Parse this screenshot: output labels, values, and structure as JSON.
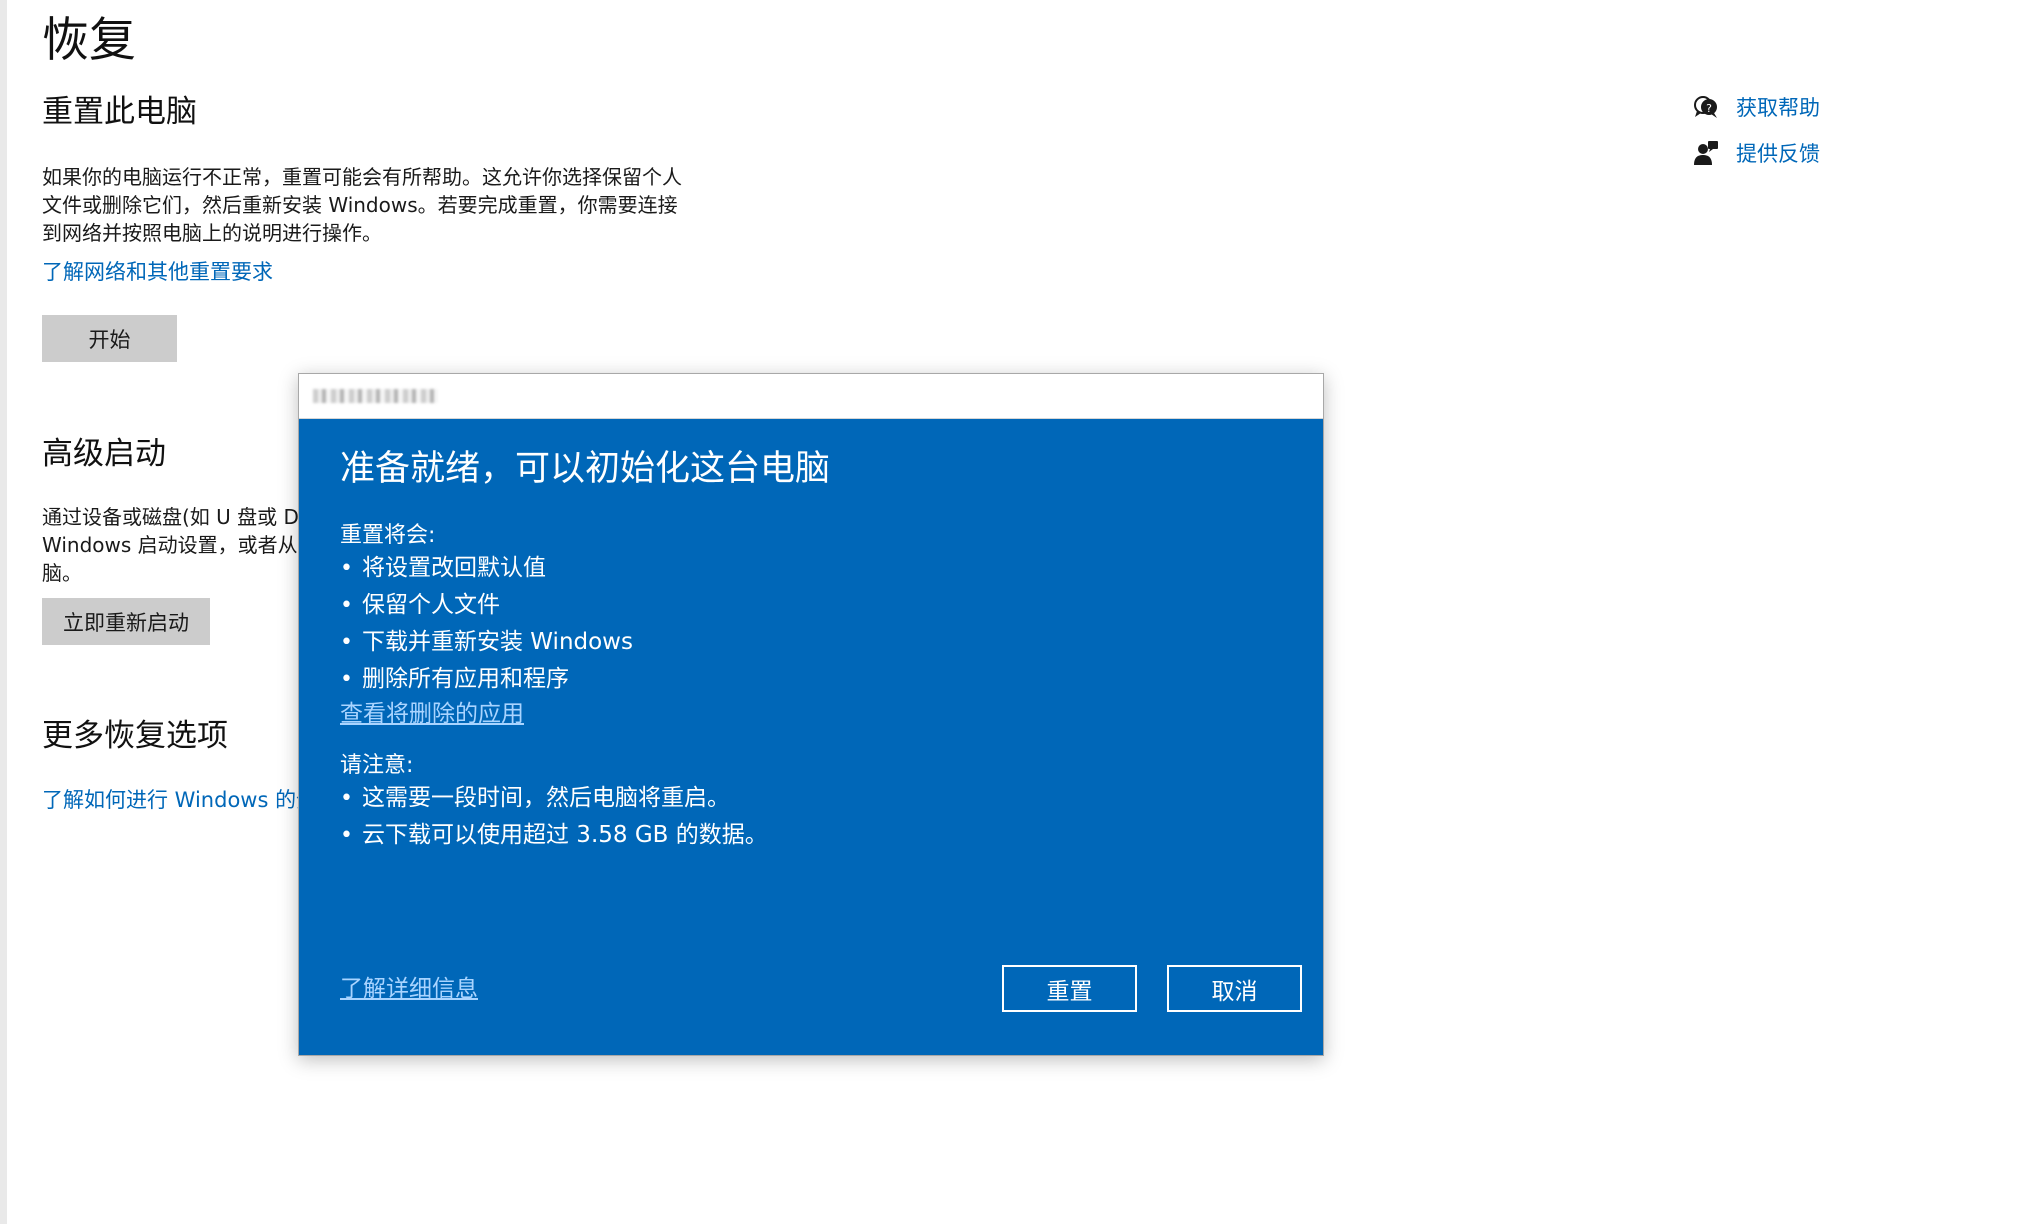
{
  "page": {
    "title": "恢复"
  },
  "reset_section": {
    "title": "重置此电脑",
    "description_lines": [
      "如果你的电脑运行不正常，重置可能会有所帮助。这允许你选择保留个人",
      "文件或删除它们，然后重新安装 Windows。若要完成重置，你需要连接",
      "到网络并按照电脑上的说明进行操作。"
    ],
    "link": "了解网络和其他重置要求",
    "button": "开始"
  },
  "advanced_section": {
    "title": "高级启动",
    "description_lines": [
      "通过设备或磁盘(如 U 盘或 D",
      "Windows 启动设置，或者从",
      "脑。"
    ],
    "button": "立即重新启动"
  },
  "more_section": {
    "title": "更多恢复选项",
    "link": "了解如何进行 Windows 的全"
  },
  "side_links": [
    {
      "icon": "help-chat-icon",
      "label": "获取帮助"
    },
    {
      "icon": "feedback-person-icon",
      "label": "提供反馈"
    }
  ],
  "dialog": {
    "heading": "准备就绪，可以初始化这台电脑",
    "will_do_label": "重置将会:",
    "will_do_items": [
      "将设置改回默认值",
      "保留个人文件",
      "下载并重新安装 Windows",
      "删除所有应用和程序"
    ],
    "view_apps_link": "查看将删除的应用",
    "note_label": "请注意:",
    "note_items": [
      "这需要一段时间，然后电脑将重启。",
      "云下载可以使用超过 3.58 GB 的数据。"
    ],
    "learn_more_link": "了解详细信息",
    "reset_button": "重置",
    "cancel_button": "取消"
  },
  "colors": {
    "accent": "#0067b8",
    "dialog_bg": "#0067b8",
    "link": "#0067b8",
    "button_gray": "#cccccc"
  }
}
